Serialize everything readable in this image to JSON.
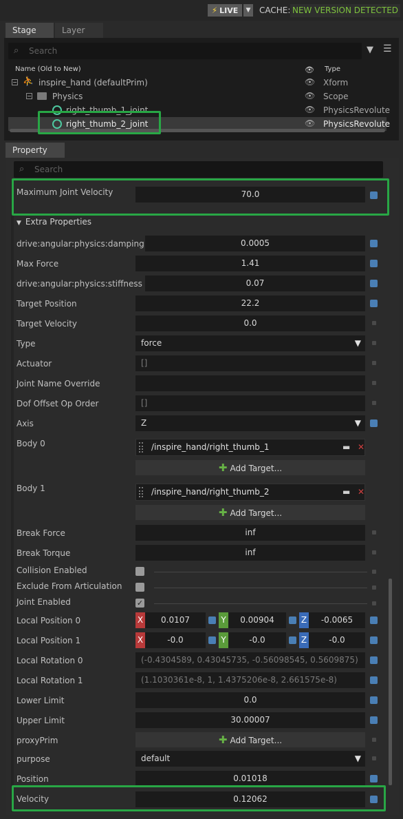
{
  "topbar": {
    "live_label": "LIVE",
    "cache_label": "CACHE:",
    "cache_status": "NEW VERSION DETECTED"
  },
  "stage": {
    "tabs": [
      "Stage",
      "Layer"
    ],
    "search_placeholder": "Search",
    "columns": {
      "name": "Name (Old to New)",
      "type": "Type"
    },
    "rows": [
      {
        "name": "inspire_hand (defaultPrim)",
        "type": "Xform"
      },
      {
        "name": "Physics",
        "type": "Scope"
      },
      {
        "name": "right_thumb_1_joint",
        "type": "PhysicsRevolute"
      },
      {
        "name": "right_thumb_2_joint",
        "type": "PhysicsRevolute"
      }
    ]
  },
  "property": {
    "tab": "Property",
    "search_placeholder": "Search",
    "max_joint_velocity": {
      "label": "Maximum Joint Velocity",
      "value": "70.0"
    },
    "extra_section": "Extra Properties",
    "rows": [
      {
        "label": "drive:angular:physics:damping",
        "value": "0.0005"
      },
      {
        "label": "Max Force",
        "value": "1.41"
      },
      {
        "label": "drive:angular:physics:stiffness",
        "value": "0.07"
      },
      {
        "label": "Target Position",
        "value": "22.2"
      },
      {
        "label": "Target Velocity",
        "value": "0.0"
      },
      {
        "label": "Type",
        "value": "force"
      },
      {
        "label": "Actuator",
        "value": "[]"
      },
      {
        "label": "Joint Name Override",
        "value": ""
      },
      {
        "label": "Dof Offset Op Order",
        "value": "[]"
      },
      {
        "label": "Axis",
        "value": "Z"
      }
    ],
    "body0": {
      "label": "Body 0",
      "target": "/inspire_hand/right_thumb_1",
      "add": "Add Target..."
    },
    "body1": {
      "label": "Body 1",
      "target": "/inspire_hand/right_thumb_2",
      "add": "Add Target..."
    },
    "break_force": {
      "label": "Break Force",
      "value": "inf"
    },
    "break_torque": {
      "label": "Break Torque",
      "value": "inf"
    },
    "collision_enabled": {
      "label": "Collision Enabled"
    },
    "exclude_articulation": {
      "label": "Exclude From Articulation"
    },
    "joint_enabled": {
      "label": "Joint Enabled"
    },
    "local_pos0": {
      "label": "Local Position 0",
      "x": "0.0107",
      "y": "0.00904",
      "z": "-0.0065"
    },
    "local_pos1": {
      "label": "Local Position 1",
      "x": "-0.0",
      "y": "-0.0",
      "z": "-0.0"
    },
    "local_rot0": {
      "label": "Local Rotation 0",
      "value": "(-0.4304589, 0.43045735, -0.56098545, 0.5609875)"
    },
    "local_rot1": {
      "label": "Local Rotation 1",
      "value": "(1.1030361e-8, 1, 1.4375206e-8, 2.661575e-8)"
    },
    "lower_limit": {
      "label": "Lower Limit",
      "value": "0.0"
    },
    "upper_limit": {
      "label": "Upper Limit",
      "value": "30.00007"
    },
    "proxy_prim": {
      "label": "proxyPrim",
      "add": "Add Target..."
    },
    "purpose": {
      "label": "purpose",
      "value": "default"
    },
    "position": {
      "label": "Position",
      "value": "0.01018"
    },
    "velocity": {
      "label": "Velocity",
      "value": "0.12062"
    }
  },
  "colors": {
    "highlight": "#28a745",
    "cache_status": "#7ec33e",
    "mark": "#4a7fb5"
  }
}
